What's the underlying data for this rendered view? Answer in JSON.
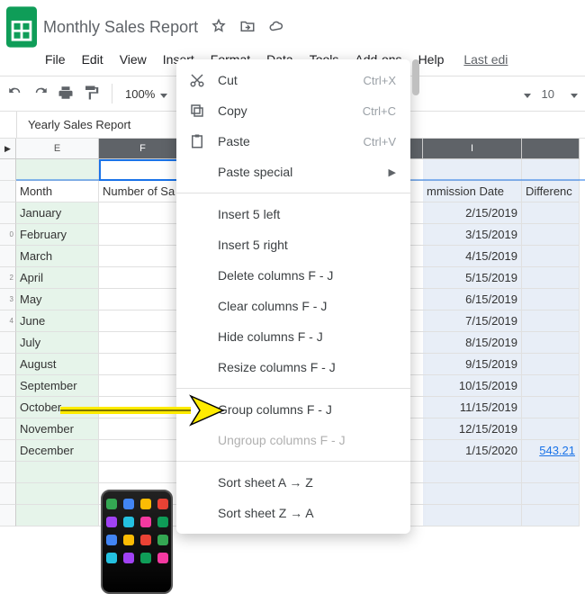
{
  "doc": {
    "title": "Monthly Sales Report"
  },
  "menu": {
    "file": "File",
    "edit": "Edit",
    "view": "View",
    "insert": "Insert",
    "format": "Format",
    "data": "Data",
    "tools": "Tools",
    "addons": "Add-ons",
    "help": "Help",
    "last_edit": "Last edi"
  },
  "toolbar": {
    "zoom": "100%",
    "font_size": "10"
  },
  "tab": {
    "name": "Yearly Sales Report"
  },
  "cols": {
    "E": "E",
    "F": "F",
    "I": "I"
  },
  "headers": {
    "month": "Month",
    "num_sa": "Number of Sa",
    "commission": "mmission Date",
    "diff": "Differenc"
  },
  "months": [
    "January",
    "February",
    "March",
    "April",
    "May",
    "June",
    "July",
    "August",
    "September",
    "October",
    "November",
    "December"
  ],
  "commission_dates": [
    "2/15/2019",
    "3/15/2019",
    "4/15/2019",
    "5/15/2019",
    "6/15/2019",
    "7/15/2019",
    "8/15/2019",
    "9/15/2019",
    "10/15/2019",
    "11/15/2019",
    "12/15/2019",
    "1/15/2020"
  ],
  "diff_value": "543.21",
  "row_nums": [
    "",
    "",
    "",
    "0",
    "",
    "2",
    "3",
    "4",
    "",
    "",
    "",
    "",
    "",
    "",
    "",
    "",
    ""
  ],
  "ctx": {
    "cut": "Cut",
    "cut_sc": "Ctrl+X",
    "copy": "Copy",
    "copy_sc": "Ctrl+C",
    "paste": "Paste",
    "paste_sc": "Ctrl+V",
    "paste_special": "Paste special",
    "insert_left": "Insert 5 left",
    "insert_right": "Insert 5 right",
    "delete": "Delete columns F - J",
    "clear": "Clear columns F - J",
    "hide": "Hide columns F - J",
    "resize": "Resize columns F - J",
    "group": "Group columns F - J",
    "ungroup": "Ungroup columns F - J",
    "sort_az": "Sort sheet A → Z",
    "sort_za": "Sort sheet Z → A"
  }
}
